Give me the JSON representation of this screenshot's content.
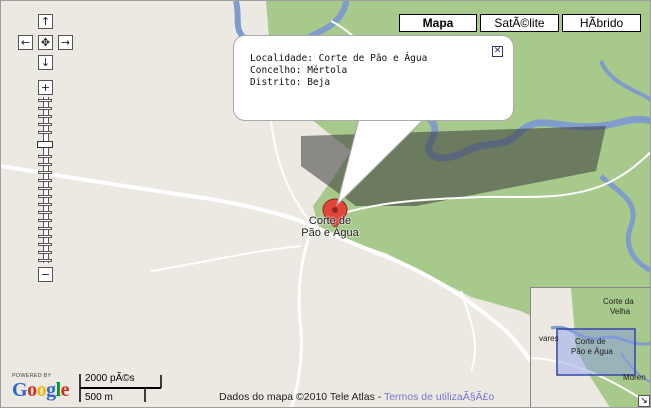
{
  "map_types": {
    "map_label": "Mapa",
    "satellite_label": "SatÃ©lite",
    "hybrid_label": "HÃbrido",
    "active": "Mapa"
  },
  "pan_control": {
    "up": "↑",
    "down": "↓",
    "left": "←",
    "right": "→",
    "center": "✥"
  },
  "zoom_control": {
    "plus": "+",
    "minus": "−"
  },
  "info_window": {
    "line1": "Localidade: Corte de Pão e Água",
    "line2": "Concelho: Mértola",
    "line3": "Distrito: Beja",
    "close_icon": "✕"
  },
  "marker": {
    "icon": "map-pin-icon",
    "label_line1": "Corte de",
    "label_line2": "Pão e Água",
    "color": "#e0463a"
  },
  "overview_map": {
    "label_top": "Corte da",
    "label_top2": "Velha",
    "label_center1": "Corte de",
    "label_center2": "Pão e Água",
    "label_left": "vares",
    "label_right": "Moren",
    "collapse_icon": "↘"
  },
  "attribution": {
    "text": "Dados do mapa ©2010 Tele Atlas - ",
    "terms_link": "Termos de utilizaÃ§Ã£o"
  },
  "scale": {
    "imperial": "2000 pÃ©s",
    "metric": "500 m"
  },
  "logo": {
    "powered_by": "POWERED BY",
    "letters": [
      "G",
      "o",
      "o",
      "g",
      "l",
      "e"
    ],
    "letter_colors": [
      "#3366cc",
      "#d62d20",
      "#f2b705",
      "#3366cc",
      "#009925",
      "#d62d20"
    ]
  },
  "colors": {
    "land": "#ece9e2",
    "green_area": "#a8c98c",
    "river": "#7f9ccb",
    "road": "#ffffff"
  }
}
